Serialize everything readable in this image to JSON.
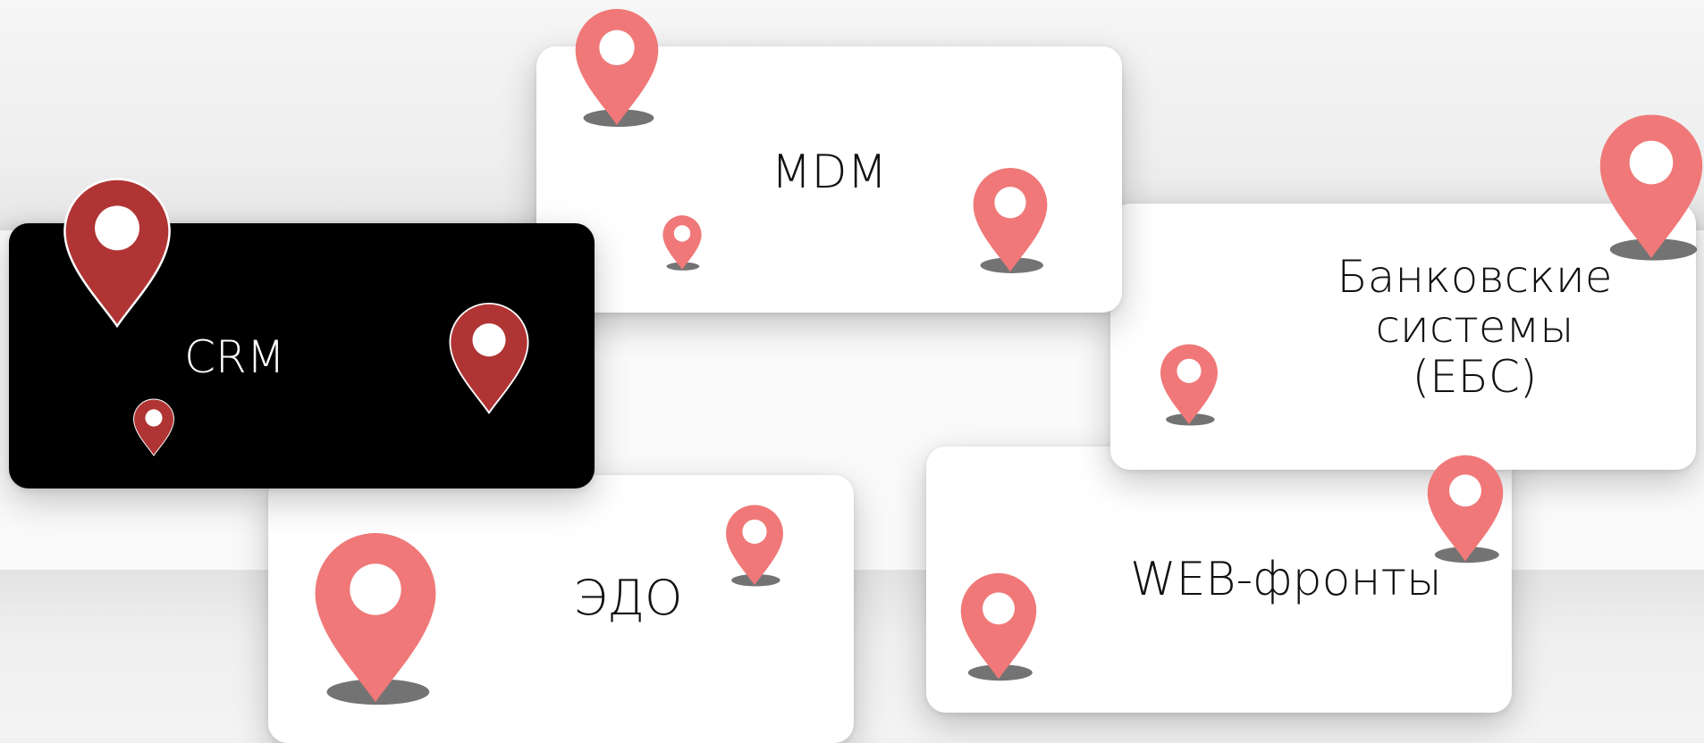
{
  "cards": {
    "mdm": {
      "label": "MDM"
    },
    "crm": {
      "label": "CRM"
    },
    "edo": {
      "label": "ЭДО"
    },
    "bank": {
      "label": "Банковские\nсистемы\n(ЕБС)"
    },
    "web": {
      "label": "WEB-фронты"
    }
  },
  "icons": {
    "pin": "map-pin-icon"
  },
  "colors": {
    "pin_light": "#f07878",
    "pin_dark": "#b03434",
    "pin_hole": "#ffffff",
    "dark_card": "#000000",
    "light_card": "#ffffff"
  }
}
